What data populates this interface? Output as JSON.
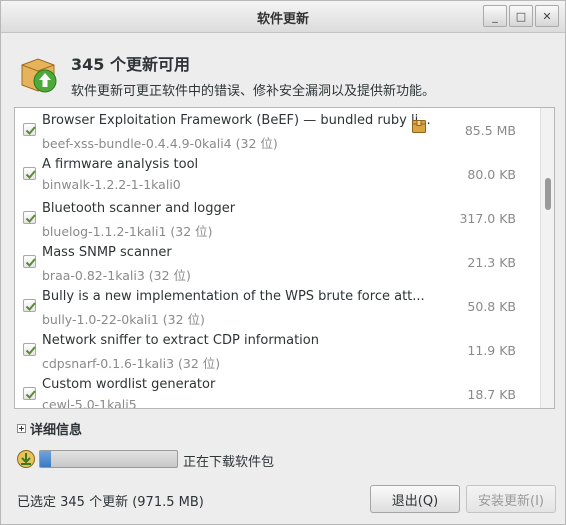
{
  "window": {
    "title": "软件更新"
  },
  "wm": {
    "minimize": "_",
    "maximize": "□",
    "close": "✕"
  },
  "header": {
    "title": "345 个更新可用",
    "subtitle": "软件更新可更正软件中的错误、修补安全漏洞以及提供新功能。"
  },
  "updates": [
    {
      "name": "Browser Exploitation Framework (BeEF) — bundled ruby li...",
      "package": "beef-xss-bundle-0.4.4.9-0kali4 (32 位)",
      "size": "85.5 MB",
      "checked": true,
      "has_icon": true
    },
    {
      "name": "A firmware analysis tool",
      "package": "binwalk-1.2.2-1-1kali0",
      "size": "80.0 KB",
      "checked": true
    },
    {
      "name": "Bluetooth scanner and logger",
      "package": "bluelog-1.1.2-1kali1 (32 位)",
      "size": "317.0 KB",
      "checked": true
    },
    {
      "name": "Mass SNMP scanner",
      "package": "braa-0.82-1kali3 (32 位)",
      "size": "21.3 KB",
      "checked": true
    },
    {
      "name": "Bully is a new implementation of the WPS brute force att...",
      "package": "bully-1.0-22-0kali1 (32 位)",
      "size": "50.8 KB",
      "checked": true
    },
    {
      "name": "Network sniffer to extract CDP information",
      "package": "cdpsnarf-0.1.6-1kali3 (32 位)",
      "size": "11.9 KB",
      "checked": true
    },
    {
      "name": "Custom wordlist generator",
      "package": "cewl-5.0-1kali5",
      "size": "18.7 KB",
      "checked": true
    }
  ],
  "details": {
    "label": "详细信息"
  },
  "progress": {
    "label": "正在下载软件包",
    "fraction": 0.08
  },
  "footer": {
    "status": "已选定 345 个更新 (971.5 MB)",
    "quit_label": "退出(Q)",
    "install_label": "安装更新(I)"
  },
  "colors": {
    "accent": "#3a78c2",
    "check": "#5a8a3a"
  }
}
